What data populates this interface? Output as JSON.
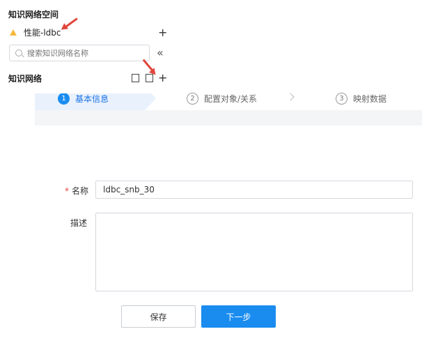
{
  "sidebar": {
    "title": "知识网络空间",
    "workspace": {
      "name": "性能-ldbc"
    },
    "search_placeholder": "搜索知识网络名称",
    "section_title": "知识网络"
  },
  "steps": [
    {
      "num": "1",
      "label": "基本信息",
      "active": true
    },
    {
      "num": "2",
      "label": "配置对象/关系",
      "active": false
    },
    {
      "num": "3",
      "label": "映射数据",
      "active": false
    }
  ],
  "form": {
    "name_label": "名称",
    "required_mark": "*",
    "name_value": "ldbc_snb_30",
    "desc_label": "描述",
    "desc_value": ""
  },
  "buttons": {
    "save": "保存",
    "next": "下一步"
  },
  "colors": {
    "primary": "#1a8cf0",
    "annotation_arrow": "#e0463c",
    "warning": "#f5b83d"
  }
}
